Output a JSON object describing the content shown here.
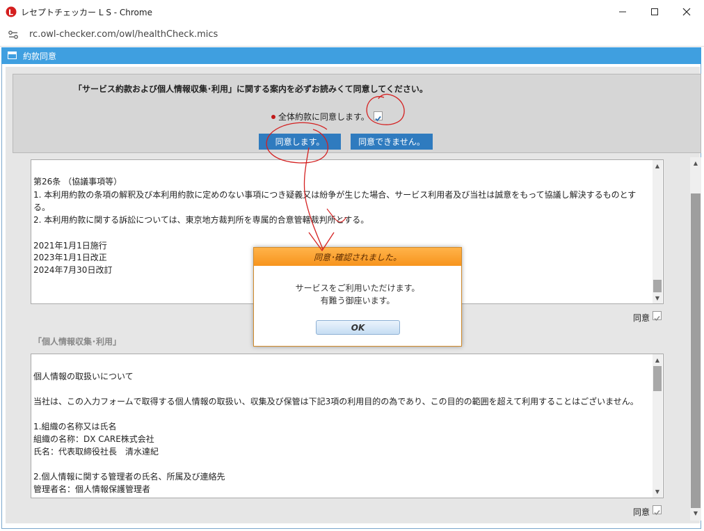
{
  "window": {
    "title": "レセプトチェッカー L S - Chrome",
    "url": "rc.owl-checker.com/owl/healthCheck.mics",
    "minimize_glyph": "—",
    "maximize_glyph": "☐",
    "close_glyph": "✕"
  },
  "dialog": {
    "title": "約款同意"
  },
  "top": {
    "instruction": "「サービス約款および個人情報収集･利用」に関する案内を必ずお読みくて同意してください。",
    "agree_all_label": "全体約款に同意します。",
    "agree_button": "同意します。",
    "disagree_button": "同意できません。"
  },
  "terms_box": {
    "lines": [
      "第26条 （協議事項等）",
      "1. 本利用約款の条項の解釈及び本利用約款に定めのない事項につき疑義又は紛争が生じた場合、サービス利用者及び当社は誠意をもって協議し解決するものとす",
      "る。",
      "2. 本利用約款に関する訴訟については、東京地方裁判所を専属的合意管轄裁判所とする。",
      "",
      "2021年1月1日施行",
      "2023年1月1日改正",
      "2024年7月30日改訂"
    ],
    "agree_label": "同意"
  },
  "privacy": {
    "section_title": "「個人情報収集･利用」",
    "lines": [
      "個人情報の取扱いについて",
      "",
      "当社は、この入力フォームで取得する個人情報の取扱い、収集及び保管は下記3項の利用目的の為であり、この目的の範囲を超えて利用することはございません。",
      "",
      "1.組織の名称又は氏名",
      "組織の名称：DX CARE株式会社",
      "氏名：代表取締役社長　清水達紀",
      "",
      "2.個人情報に関する管理者の氏名、所属及び連絡先",
      "管理者名：個人情報保護管理者"
    ],
    "agree_label": "同意"
  },
  "modal": {
    "title": "同意･確認されました。",
    "message_line1": "サービスをご利用いただけます。",
    "message_line2": "有難う御座います。",
    "ok_button": "OK"
  },
  "colors": {
    "header_blue": "#3f9fe0",
    "button_blue": "#2f7bbf",
    "modal_orange": "#f7941d",
    "annotation_red": "#d42020"
  }
}
